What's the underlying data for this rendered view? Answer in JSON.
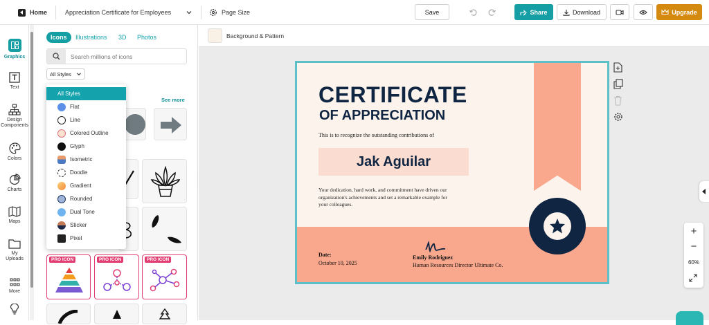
{
  "topbar": {
    "home": "Home",
    "doc_title": "Appreciation Certificate for Employees",
    "page_size": "Page Size",
    "save": "Save",
    "share": "Share",
    "download": "Download",
    "upgrade": "Upgrade",
    "share_color": "#159ea3",
    "upgrade_color": "#d48a0f"
  },
  "rail": [
    {
      "label": "Graphics",
      "icon": "graphics-icon"
    },
    {
      "label": "Text",
      "icon": "text-icon"
    },
    {
      "label": "Design Components",
      "icon": "components-icon"
    },
    {
      "label": "Colors",
      "icon": "palette-icon"
    },
    {
      "label": "Charts",
      "icon": "chart-icon"
    },
    {
      "label": "Maps",
      "icon": "map-icon"
    },
    {
      "label": "My Uploads",
      "icon": "folder-icon"
    },
    {
      "label": "More",
      "icon": "grid-icon"
    }
  ],
  "panel": {
    "tabs": [
      "Icons",
      "Illustrations",
      "3D",
      "Photos"
    ],
    "search_placeholder": "Search millions of icons",
    "style_select": "All Styles",
    "see_more": "See more",
    "pro_badge": "PRO ICON"
  },
  "dropdown": {
    "items": [
      "All Styles",
      "Flat",
      "Line",
      "Colored Outline",
      "Glyph",
      "Isometric",
      "Doodle",
      "Gradient",
      "Rounded",
      "Dual Tone",
      "Sticker",
      "Pixel"
    ],
    "selected": "All Styles"
  },
  "canvas": {
    "background_pattern": "Background & Pattern",
    "zoom": "60%"
  },
  "certificate": {
    "title": "CERTIFICATE",
    "subtitle": "OF APPRECIATION",
    "intro": "This is to recognize the outstanding contributions of",
    "name": "Jak Aguilar",
    "body": "Your dedication, hard work, and commitment have driven our organization's achievements and set a remarkable example for your colleagues.",
    "date_label": "Date:",
    "date_value": "October 10, 2025",
    "signer_name": "Emily Rodriguez",
    "signer_title": "Human Resources Director Ultimate Co.",
    "navy": "#0f2542",
    "salmon": "#f9a88e"
  }
}
